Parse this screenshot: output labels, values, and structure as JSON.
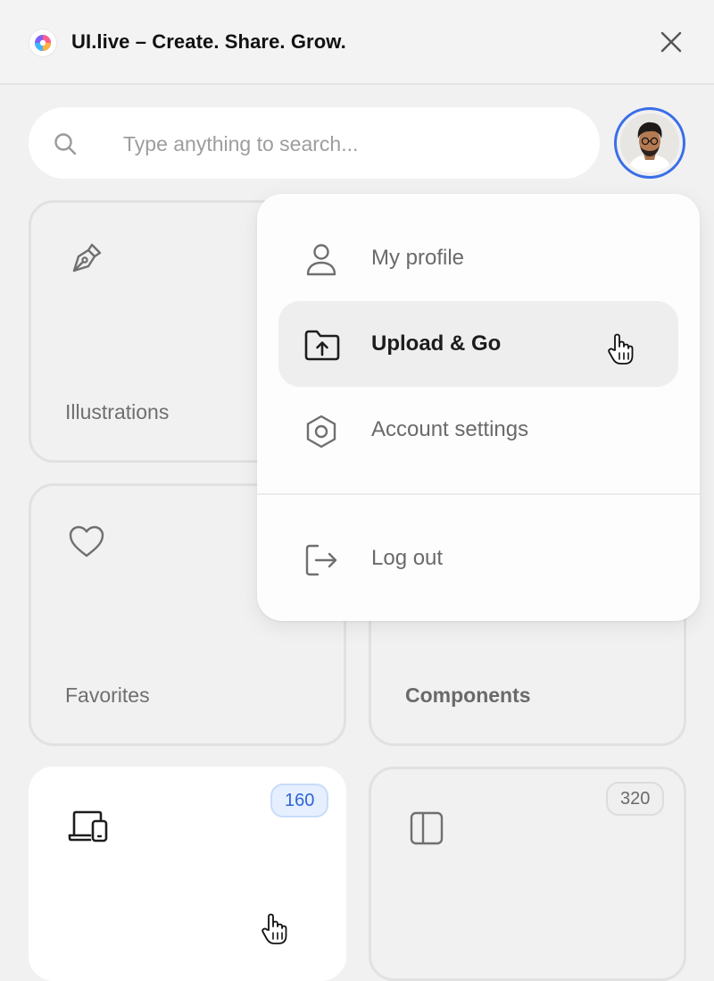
{
  "window": {
    "title": "UI.live – Create. Share. Grow.",
    "logo_icon": "ui-live-logo",
    "close_icon": "close-icon"
  },
  "search": {
    "placeholder": "Type anything to search...",
    "value": "",
    "icon": "search-icon"
  },
  "user": {
    "avatar_icon": "user-avatar",
    "accent_color": "#3a6ee8"
  },
  "cards": [
    {
      "label": "Illustrations",
      "icon": "pen-tool-icon"
    },
    {
      "label": "Favorites",
      "icon": "heart-icon"
    },
    {
      "label": "Components",
      "icon": "components-icon"
    },
    {
      "label": "",
      "icon": "devices-icon",
      "badge": "160",
      "badge_color": "#2f63d6"
    },
    {
      "label": "",
      "icon": "sidebar-layout-icon",
      "badge": "320"
    }
  ],
  "menu": {
    "items": [
      {
        "label": "My profile",
        "icon": "user-icon"
      },
      {
        "label": "Upload & Go",
        "icon": "folder-upload-icon",
        "active": true
      },
      {
        "label": "Account settings",
        "icon": "hexagon-settings-icon"
      },
      {
        "label": "Log out",
        "icon": "logout-icon"
      }
    ]
  },
  "colors": {
    "background": "#f1f1f1",
    "surface": "#ffffff",
    "badge_blue": "#2f63d6"
  }
}
